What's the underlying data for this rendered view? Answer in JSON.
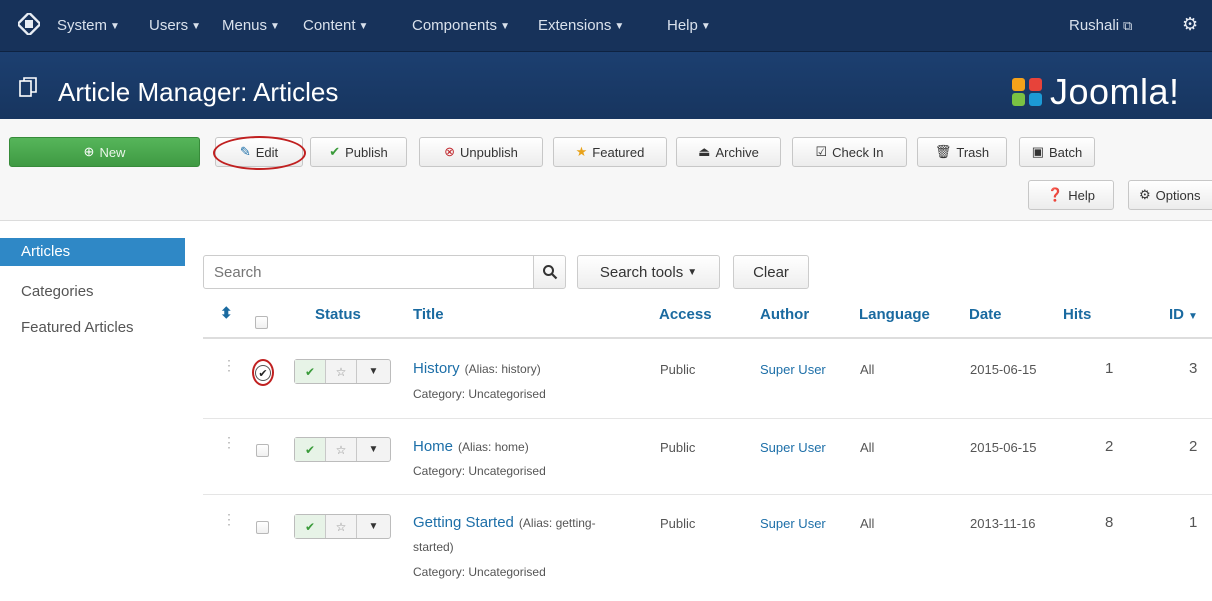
{
  "topnav": {
    "items": [
      "System",
      "Users",
      "Menus",
      "Content",
      "Components",
      "Extensions",
      "Help"
    ],
    "user": "Rushali",
    "user_icon": "external-link-icon",
    "settings_icon": "gear-icon"
  },
  "page": {
    "title": "Article Manager: Articles",
    "brand": "Joomla!"
  },
  "toolbar": {
    "new": "New",
    "edit": "Edit",
    "publish": "Publish",
    "unpublish": "Unpublish",
    "featured": "Featured",
    "archive": "Archive",
    "checkin": "Check In",
    "trash": "Trash",
    "batch": "Batch",
    "help": "Help",
    "options": "Options"
  },
  "sidebar": {
    "items": [
      "Articles",
      "Categories",
      "Featured Articles"
    ],
    "active": "Articles"
  },
  "filters": {
    "search_placeholder": "Search",
    "search_tools": "Search tools",
    "clear": "Clear"
  },
  "table": {
    "columns": [
      "Status",
      "Title",
      "Access",
      "Author",
      "Language",
      "Date",
      "Hits",
      "ID"
    ],
    "rows": [
      {
        "title": "History",
        "alias": "(Alias: history)",
        "alias_cont": "",
        "category": "Category: Uncategorised",
        "access": "Public",
        "author": "Super User",
        "language": "All",
        "date": "2015-06-15",
        "hits": "1",
        "id": "3",
        "checked": true
      },
      {
        "title": "Home",
        "alias": "(Alias: home)",
        "alias_cont": "",
        "category": "Category: Uncategorised",
        "access": "Public",
        "author": "Super User",
        "language": "All",
        "date": "2015-06-15",
        "hits": "2",
        "id": "2",
        "checked": false
      },
      {
        "title": "Getting Started",
        "alias": "(Alias: getting-",
        "alias_cont": "started)",
        "category": "Category: Uncategorised",
        "access": "Public",
        "author": "Super User",
        "language": "All",
        "date": "2013-11-16",
        "hits": "8",
        "id": "1",
        "checked": false
      }
    ]
  },
  "colors": {
    "topbar": "#17325a",
    "titlebar": "#1c3f70",
    "new_button": "#4aa84e",
    "sidebar_active": "#2f88c6",
    "link": "#1d6fa8",
    "annotation_circle": "#c02020"
  }
}
